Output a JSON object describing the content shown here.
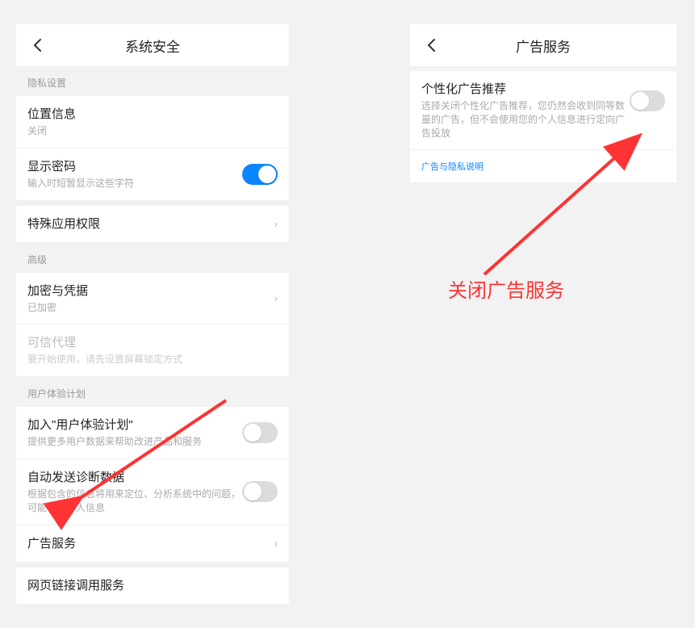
{
  "left": {
    "title": "系统安全",
    "sec_privacy": "隐私设置",
    "loc_title": "位置信息",
    "loc_sub": "关闭",
    "pwd_title": "显示密码",
    "pwd_sub": "输入时短暂显示这些字符",
    "special_perm": "特殊应用权限",
    "sec_adv": "高级",
    "enc_title": "加密与凭据",
    "enc_sub": "已加密",
    "trust_title": "可信代理",
    "trust_sub": "要开始使用，请先设置屏幕锁定方式",
    "sec_ue": "用户体验计划",
    "ue_title": "加入\"用户体验计划\"",
    "ue_sub": "提供更多用户数据来帮助改进产品和服务",
    "diag_title": "自动发送诊断数据",
    "diag_sub": "根据包含的信息将用来定位、分析系统中的问题，可能包含个人信息",
    "ad_service": "广告服务",
    "web_link": "网页链接调用服务"
  },
  "right": {
    "title": "广告服务",
    "pa_title": "个性化广告推荐",
    "pa_sub": "选择关闭个性化广告推荐，您仍然会收到同等数量的广告，但不会使用您的个人信息进行定向广告投放",
    "link": "广告与隐私说明"
  },
  "annotation": "关闭广告服务"
}
